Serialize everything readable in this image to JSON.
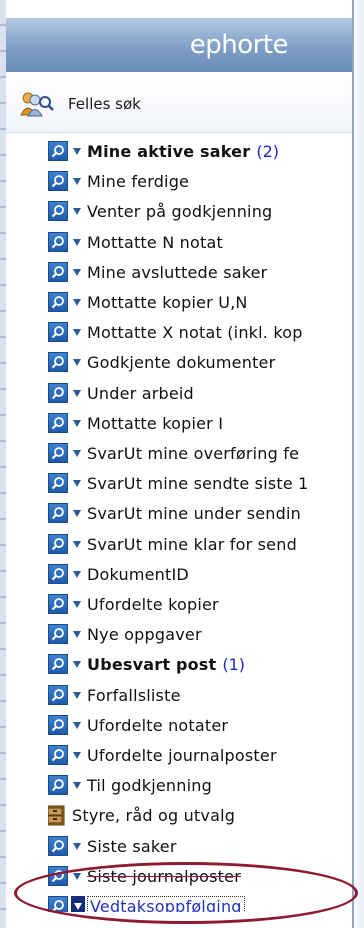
{
  "header": {
    "logo": "ephorte"
  },
  "felles": {
    "label": "Felles søk"
  },
  "items": [
    {
      "label": "Mine aktive saker",
      "bold": true,
      "count": "(2)"
    },
    {
      "label": "Mine ferdige"
    },
    {
      "label": "Venter på godkjenning"
    },
    {
      "label": "Mottatte N notat"
    },
    {
      "label": "Mine avsluttede saker"
    },
    {
      "label": "Mottatte kopier U,N"
    },
    {
      "label": "Mottatte X notat (inkl. kop"
    },
    {
      "label": "Godkjente dokumenter"
    },
    {
      "label": "Under arbeid"
    },
    {
      "label": "Mottatte kopier I"
    },
    {
      "label": "SvarUt mine overføring fe"
    },
    {
      "label": "SvarUt mine sendte siste 1"
    },
    {
      "label": "SvarUt mine under sendin"
    },
    {
      "label": "SvarUt mine klar for send"
    },
    {
      "label": "DokumentID"
    },
    {
      "label": "Ufordelte kopier"
    },
    {
      "label": "Nye oppgaver"
    },
    {
      "label": "Ubesvart post",
      "bold": true,
      "count": "(1)"
    },
    {
      "label": "Forfallsliste"
    },
    {
      "label": "Ufordelte notater"
    },
    {
      "label": "Ufordelte journalposter"
    },
    {
      "label": "Til godkjenning"
    },
    {
      "label": "Styre, råd og utvalg",
      "type": "folder"
    },
    {
      "label": "Siste saker"
    },
    {
      "label": "Siste journalposter",
      "strike": true
    },
    {
      "label": "Vedtaksoppfølging",
      "selected": true
    }
  ],
  "colors": {
    "accent": "#1f5aa8",
    "count": "#1a28c8",
    "highlight": "#8e1b33"
  }
}
